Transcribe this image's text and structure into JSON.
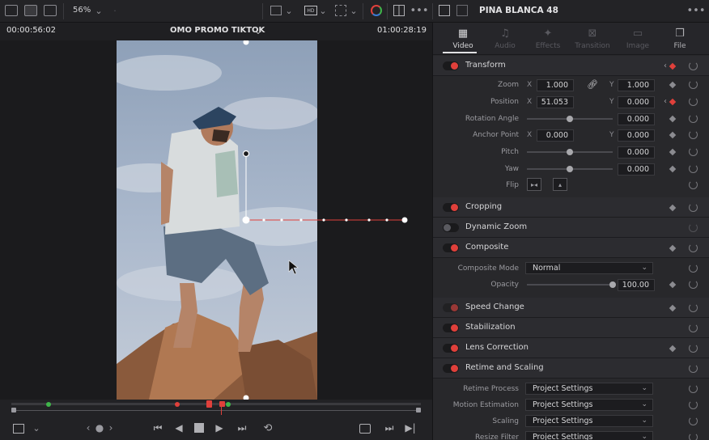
{
  "toolbar": {
    "zoom": "56%",
    "clip_name": "PINA BLANCA 48"
  },
  "viewer": {
    "timecode_left": "00:00:56:02",
    "timeline_name": "OMO PROMO TIKTOK",
    "timecode_right": "01:00:28:19"
  },
  "inspector": {
    "tabs": [
      {
        "label": "Video",
        "icon": "film-icon",
        "active": true
      },
      {
        "label": "Audio",
        "icon": "music-note-icon",
        "active": false
      },
      {
        "label": "Effects",
        "icon": "magic-wand-icon",
        "active": false
      },
      {
        "label": "Transition",
        "icon": "transition-icon",
        "active": false
      },
      {
        "label": "Image",
        "icon": "image-icon",
        "active": false
      },
      {
        "label": "File",
        "icon": "file-icon",
        "active": false
      }
    ],
    "transform": {
      "title": "Transform",
      "zoom_label": "Zoom",
      "zoom_x": "1.000",
      "zoom_y": "1.000",
      "position_label": "Position",
      "position_x": "51.053",
      "position_y": "0.000",
      "rotation_label": "Rotation Angle",
      "rotation": "0.000",
      "anchor_label": "Anchor Point",
      "anchor_x": "0.000",
      "anchor_y": "0.000",
      "pitch_label": "Pitch",
      "pitch": "0.000",
      "yaw_label": "Yaw",
      "yaw": "0.000",
      "flip_label": "Flip",
      "x": "X",
      "y": "Y"
    },
    "cropping": "Cropping",
    "dynamic_zoom": "Dynamic Zoom",
    "composite": {
      "title": "Composite",
      "mode_label": "Composite Mode",
      "mode": "Normal",
      "opacity_label": "Opacity",
      "opacity": "100.00"
    },
    "speed_change": "Speed Change",
    "stabilization": "Stabilization",
    "lens_correction": "Lens Correction",
    "retime": {
      "title": "Retime and Scaling",
      "process_label": "Retime Process",
      "process": "Project Settings",
      "motion_label": "Motion Estimation",
      "motion": "Project Settings",
      "scaling_label": "Scaling",
      "scaling": "Project Settings",
      "resize_label": "Resize Filter",
      "resize": "Project Settings"
    }
  },
  "colors": {
    "accent": "#e0403b",
    "panel": "#28282b"
  }
}
